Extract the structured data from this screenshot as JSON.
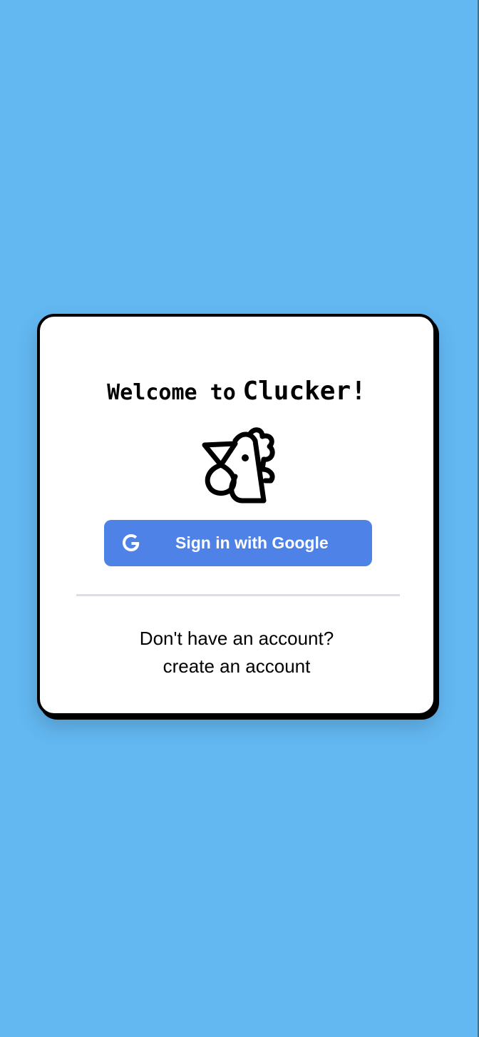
{
  "page": {
    "background_color": "#63b8f2"
  },
  "card": {
    "title_prefix": "Welcome to",
    "title_brand": "Clucker!",
    "logo_icon": "chicken-icon"
  },
  "google_button": {
    "label": "Sign in with Google",
    "icon": "google-g-icon",
    "background_color": "#4f82e6",
    "text_color": "#ffffff"
  },
  "footer": {
    "prompt": "Don't have an account?",
    "create_link": "create an account"
  }
}
